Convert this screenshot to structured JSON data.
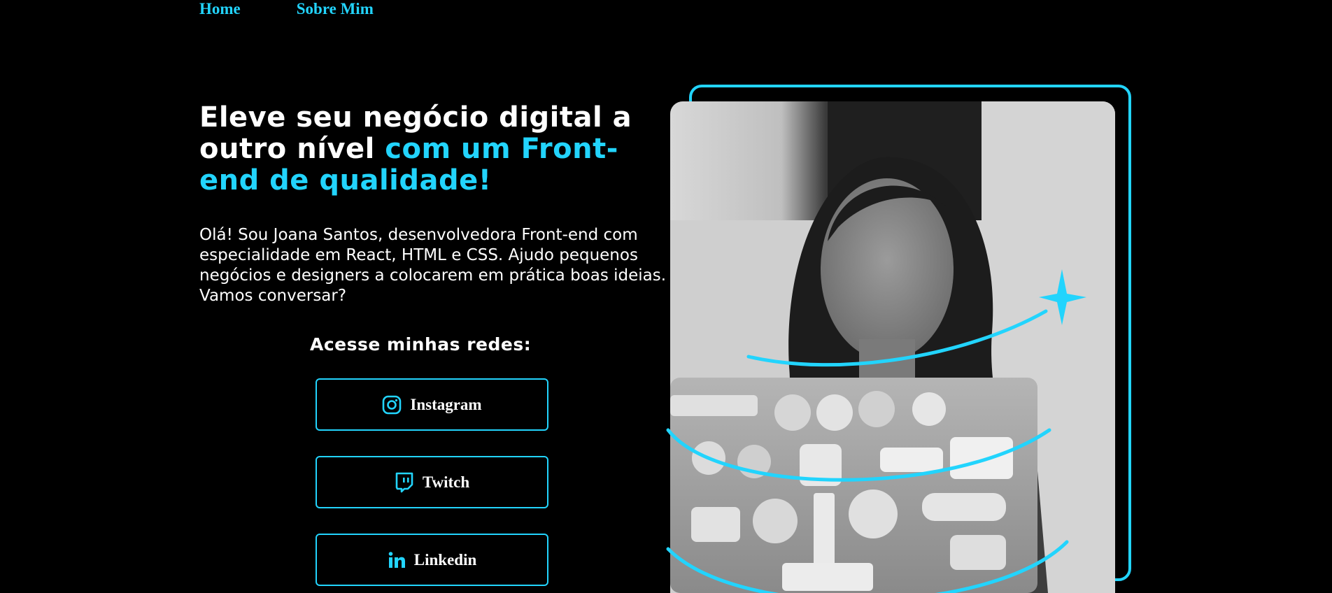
{
  "nav": {
    "home": "Home",
    "about": "Sobre Mim"
  },
  "hero": {
    "headline_white": "Eleve seu negócio digital a outro nível ",
    "headline_accent": "com um Front-end de qualidade!",
    "intro": "Olá! Sou Joana Santos, desenvolvedora Front-end com especialidade em React, HTML e CSS. Ajudo pequenos negócios e designers a colocarem em prática boas ideias. Vamos conversar?"
  },
  "socials": {
    "title": "Acesse minhas redes:",
    "buttons": [
      {
        "label": "Instagram",
        "icon": "instagram-icon"
      },
      {
        "label": "Twitch",
        "icon": "twitch-icon"
      },
      {
        "label": "Linkedin",
        "icon": "linkedin-icon"
      }
    ]
  },
  "colors": {
    "accent": "#22d4fd",
    "background": "#000000",
    "text": "#ffffff"
  }
}
